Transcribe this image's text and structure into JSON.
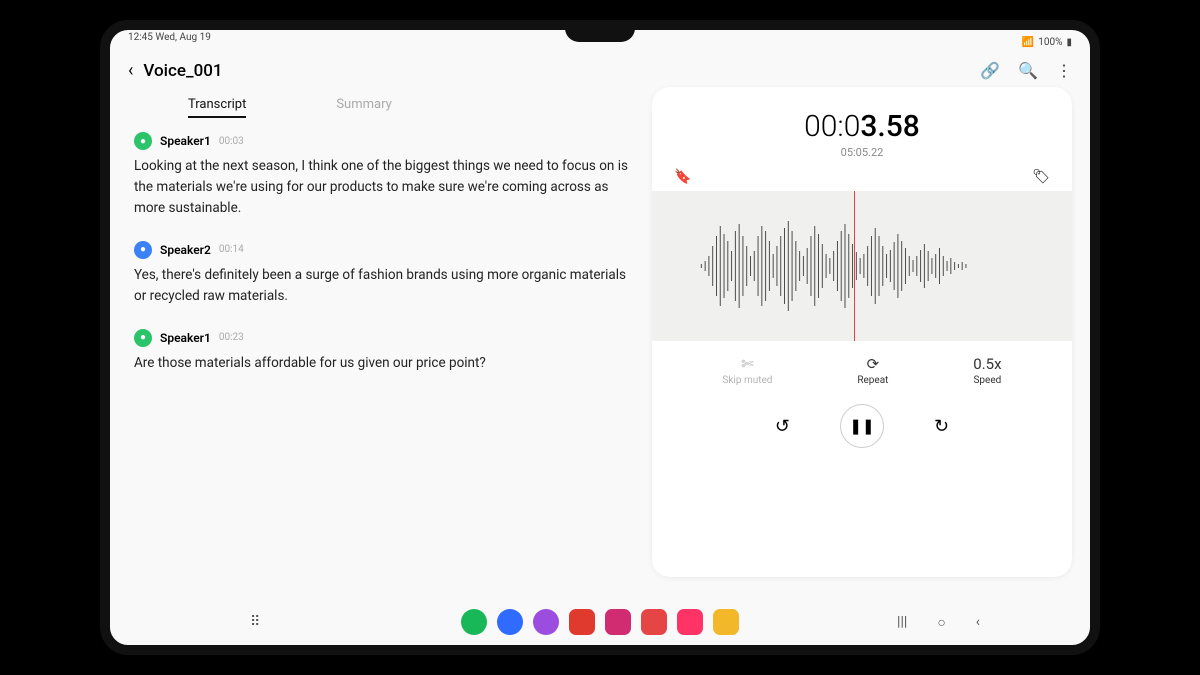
{
  "statusbar": {
    "time_date": "12:45  Wed, Aug 19",
    "battery": "100%"
  },
  "header": {
    "title": "Voice_001"
  },
  "tabs": {
    "transcript": "Transcript",
    "summary": "Summary"
  },
  "transcript": [
    {
      "speaker": "Speaker1",
      "color": "green",
      "time": "00:03",
      "text": "Looking at the next season, I think one of the biggest things we need to focus on is the materials we're using for our products to make sure we're coming across as more sustainable."
    },
    {
      "speaker": "Speaker2",
      "color": "blue",
      "time": "00:14",
      "text": "Yes, there's definitely been a surge of fashion brands using more organic materials or recycled raw materials."
    },
    {
      "speaker": "Speaker1",
      "color": "green",
      "time": "00:23",
      "text": "Are those materials affordable for us given our price point?"
    }
  ],
  "player": {
    "current_min": "00:0",
    "current_sec": "3.58",
    "total": "05:05.22",
    "skip_label": "Skip muted",
    "repeat_label": "Repeat",
    "speed_value": "0.5x",
    "speed_label": "Speed"
  },
  "dock_apps": [
    {
      "color": "#18b858",
      "shape": "circle"
    },
    {
      "color": "#2f6bff",
      "shape": "circle"
    },
    {
      "color": "#9b4de0",
      "shape": "circle"
    },
    {
      "color": "#e03a2f",
      "shape": "sq"
    },
    {
      "color": "#d12c72",
      "shape": "sq"
    },
    {
      "color": "#e64545",
      "shape": "sq"
    },
    {
      "color": "#ff3366",
      "shape": "sq"
    },
    {
      "color": "#f3b82a",
      "shape": "sq"
    }
  ]
}
